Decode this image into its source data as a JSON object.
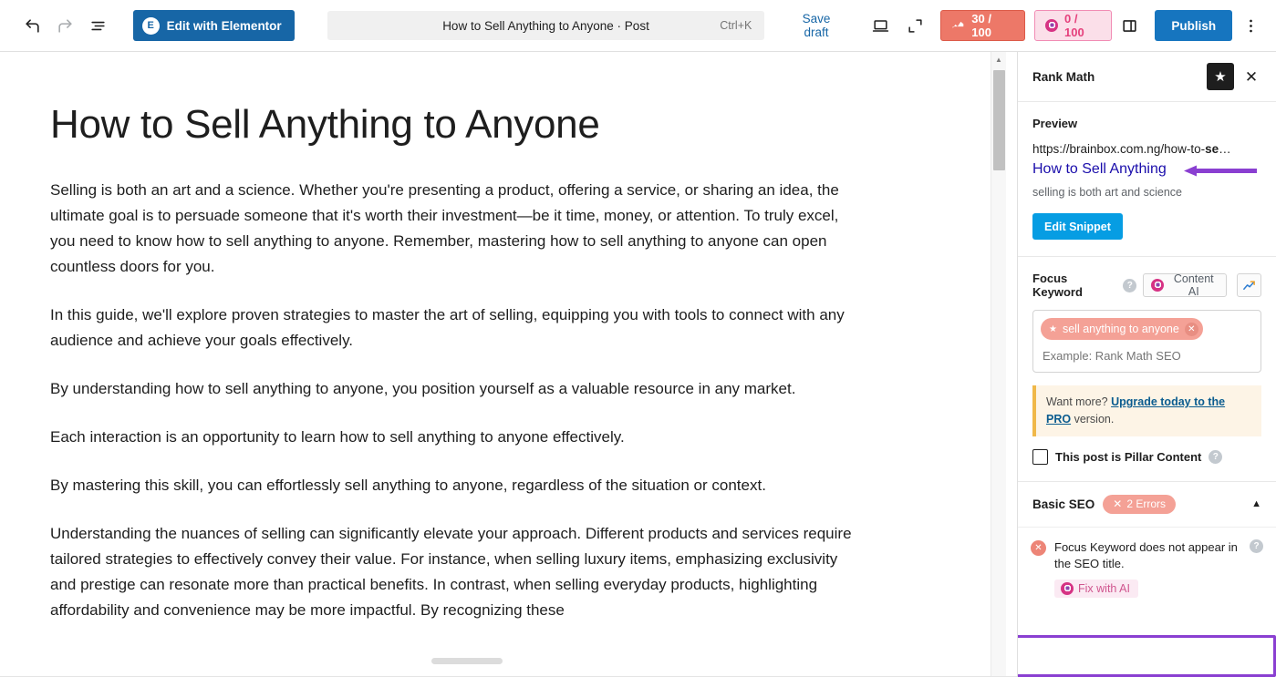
{
  "toolbar": {
    "undo_icon": "undo-arrow-icon",
    "redo_icon": "redo-arrow-icon",
    "list_view_icon": "document-overview-icon",
    "elementor_label": "Edit with Elementor",
    "elementor_badge": "E",
    "command_title": "How to Sell Anything to Anyone · Post",
    "command_shortcut": "Ctrl+K",
    "save_draft_label": "Save draft",
    "preview_icon": "desktop-preview-icon",
    "fullscreen_icon": "expand-view-icon",
    "seo_score": "30 / 100",
    "content_ai_score": "0 / 100",
    "settings_panel_icon": "sidebar-toggle-icon",
    "publish_label": "Publish",
    "options_icon": "kebab-menu-icon"
  },
  "editor": {
    "title": "How to Sell Anything to Anyone",
    "paragraphs": [
      "Selling is both an art and a science. Whether you're presenting a product, offering a service, or sharing an idea, the ultimate goal is to persuade someone that it's worth their investment—be it time, money, or attention. To truly excel, you need to know how to sell anything to anyone. Remember, mastering how to sell anything to anyone can open countless doors for you.",
      "In this guide, we'll explore proven strategies to master the art of selling, equipping you with tools to connect with any audience and achieve your goals effectively.",
      "By understanding how to sell anything to anyone, you position yourself as a valuable resource in any market.",
      "Each interaction is an opportunity to learn how to sell anything to anyone effectively.",
      "By mastering this skill, you can effortlessly sell anything to anyone, regardless of the situation or context.",
      "Understanding the nuances of selling can significantly elevate your approach. Different products and services require tailored strategies to effectively convey their value. For instance, when selling luxury items, emphasizing exclusivity and prestige can resonate more than practical benefits. In contrast, when selling everyday products, highlighting affordability and convenience may be more impactful. By recognizing these"
    ]
  },
  "rank_math": {
    "panel_title": "Rank Math",
    "star_icon": "star-icon",
    "close_icon": "close-icon",
    "preview": {
      "section_label": "Preview",
      "url_prefix": "https://brainbox.com.ng/how-to-",
      "url_keyword": "se",
      "url_suffix": "…",
      "snippet_title": "How to Sell Anything",
      "snippet_description": "selling is both art and science",
      "edit_snippet_label": "Edit Snippet",
      "annotation_arrow": "purple-left-arrow-annotation"
    },
    "focus_keyword": {
      "label": "Focus Keyword",
      "help_icon": "help-icon",
      "content_ai_label": "Content AI",
      "content_ai_icon": "content-ai-spiral-icon",
      "trend_icon": "trending-up-icon",
      "keyword_tag": "sell anything to anyone",
      "keyword_tag_star": "star-icon",
      "keyword_tag_remove": "remove-keyword-icon",
      "input_placeholder": "Example: Rank Math SEO",
      "upsell_prefix": "Want more? ",
      "upsell_link": "Upgrade today to the PRO",
      "upsell_suffix": " version.",
      "pillar_label": "This post is Pillar Content",
      "pillar_checked": false,
      "pillar_help_icon": "help-icon"
    },
    "basic_seo": {
      "title": "Basic SEO",
      "errors_badge": "2 Errors",
      "errors_badge_icon": "x-icon",
      "collapse_icon": "chevron-up-icon",
      "items": [
        {
          "status_icon": "error-x-icon",
          "text": "Focus Keyword does not appear in the SEO title.",
          "fix_label": "Fix with AI",
          "fix_icon": "content-ai-spiral-icon",
          "help_icon": "help-icon"
        }
      ],
      "annotation": "purple-highlight-box"
    }
  },
  "colors": {
    "wp_blue": "#1675bf",
    "elementor_blue": "#1766a6",
    "seo_score_red": "#ed7868",
    "content_ai_pink": "#e5407c",
    "rank_math_cyan": "#069de3",
    "keyword_salmon": "#f4a196",
    "annotation_purple": "#8a3fd1",
    "link_blue": "#1a0dab"
  }
}
